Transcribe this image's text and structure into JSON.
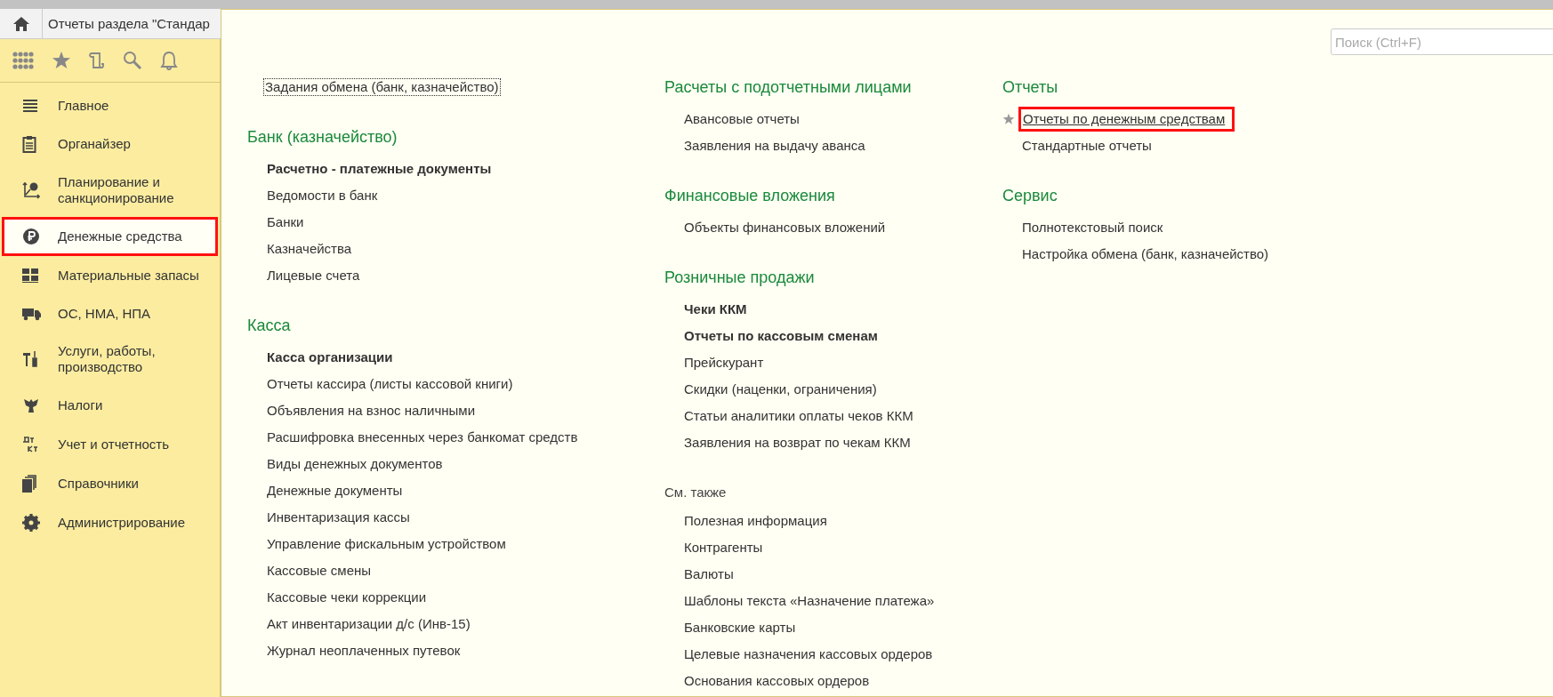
{
  "top_bar": {
    "tab": {
      "title": "Отчеты раздела \"Стандар"
    }
  },
  "sidebar": {
    "items": [
      {
        "label": "Главное",
        "selected": false
      },
      {
        "label": "Органайзер",
        "selected": false
      },
      {
        "label": "Планирование и санкционирование",
        "selected": false
      },
      {
        "label": "Денежные средства",
        "selected": true
      },
      {
        "label": "Материальные запасы",
        "selected": false
      },
      {
        "label": "ОС, НМА, НПА",
        "selected": false
      },
      {
        "label": "Услуги, работы, производство",
        "selected": false
      },
      {
        "label": "Налоги",
        "selected": false
      },
      {
        "label": "Учет и отчетность",
        "selected": false
      },
      {
        "label": "Справочники",
        "selected": false
      },
      {
        "label": "Администрирование",
        "selected": false
      }
    ]
  },
  "panel": {
    "search": {
      "placeholder": "Поиск (Ctrl+F)"
    },
    "columns": [
      [
        {
          "kind": "plain",
          "items": [
            {
              "text": "Задания обмена (банк, казначейство)",
              "kind": "focused"
            }
          ]
        },
        {
          "kind": "group",
          "title": "Банк (казначейство)",
          "items": [
            {
              "text": "Расчетно - платежные документы",
              "kind": "bold"
            },
            {
              "text": "Ведомости в банк",
              "kind": "normal"
            },
            {
              "text": "Банки",
              "kind": "normal"
            },
            {
              "text": "Казначейства",
              "kind": "normal"
            },
            {
              "text": "Лицевые счета",
              "kind": "normal"
            }
          ]
        },
        {
          "kind": "group",
          "title": "Касса",
          "items": [
            {
              "text": "Касса организации",
              "kind": "bold"
            },
            {
              "text": "Отчеты кассира (листы кассовой книги)",
              "kind": "normal"
            },
            {
              "text": "Объявления на взнос наличными",
              "kind": "normal"
            },
            {
              "text": "Расшифровка внесенных через банкомат средств",
              "kind": "normal"
            },
            {
              "text": "Виды денежных документов",
              "kind": "normal"
            },
            {
              "text": "Денежные документы",
              "kind": "normal"
            },
            {
              "text": "Инвентаризация кассы",
              "kind": "normal"
            },
            {
              "text": "Управление фискальным устройством",
              "kind": "normal"
            },
            {
              "text": "Кассовые смены",
              "kind": "normal"
            },
            {
              "text": "Кассовые чеки коррекции",
              "kind": "normal"
            },
            {
              "text": "Акт инвентаризации д/с (Инв-15)",
              "kind": "normal"
            },
            {
              "text": "Журнал неоплаченных путевок",
              "kind": "normal"
            }
          ]
        }
      ],
      [
        {
          "kind": "group",
          "title": "Расчеты с подотчетными лицами",
          "items": [
            {
              "text": "Авансовые отчеты",
              "kind": "normal"
            },
            {
              "text": "Заявления на выдачу аванса",
              "kind": "normal"
            }
          ]
        },
        {
          "kind": "group",
          "title": "Финансовые вложения",
          "items": [
            {
              "text": "Объекты финансовых вложений",
              "kind": "normal"
            }
          ]
        },
        {
          "kind": "group",
          "title": "Розничные продажи",
          "items": [
            {
              "text": "Чеки ККМ",
              "kind": "bold"
            },
            {
              "text": "Отчеты по кассовым сменам",
              "kind": "bold"
            },
            {
              "text": "Прейскурант",
              "kind": "normal"
            },
            {
              "text": "Скидки (наценки, ограничения)",
              "kind": "normal"
            },
            {
              "text": "Статьи аналитики оплаты чеков ККМ",
              "kind": "normal"
            },
            {
              "text": "Заявления на возврат по чекам ККМ",
              "kind": "normal"
            }
          ]
        },
        {
          "kind": "see_also",
          "title": "См. также",
          "items": [
            {
              "text": "Полезная информация",
              "kind": "normal"
            },
            {
              "text": "Контрагенты",
              "kind": "normal"
            },
            {
              "text": "Валюты",
              "kind": "normal"
            },
            {
              "text": "Шаблоны текста «Назначение платежа»",
              "kind": "normal"
            },
            {
              "text": "Банковские карты",
              "kind": "normal"
            },
            {
              "text": "Целевые назначения кассовых ордеров",
              "kind": "normal"
            },
            {
              "text": "Основания кассовых ордеров",
              "kind": "normal"
            }
          ]
        }
      ],
      [
        {
          "kind": "group",
          "title": "Отчеты",
          "items": [
            {
              "text": "Отчеты по денежным средствам",
              "kind": "favorite"
            },
            {
              "text": "Стандартные отчеты",
              "kind": "normal"
            }
          ]
        },
        {
          "kind": "group",
          "title": "Сервис",
          "items": [
            {
              "text": "Полнотекстовый поиск",
              "kind": "normal"
            },
            {
              "text": "Настройка обмена (банк, казначейство)",
              "kind": "normal"
            }
          ]
        }
      ]
    ]
  }
}
